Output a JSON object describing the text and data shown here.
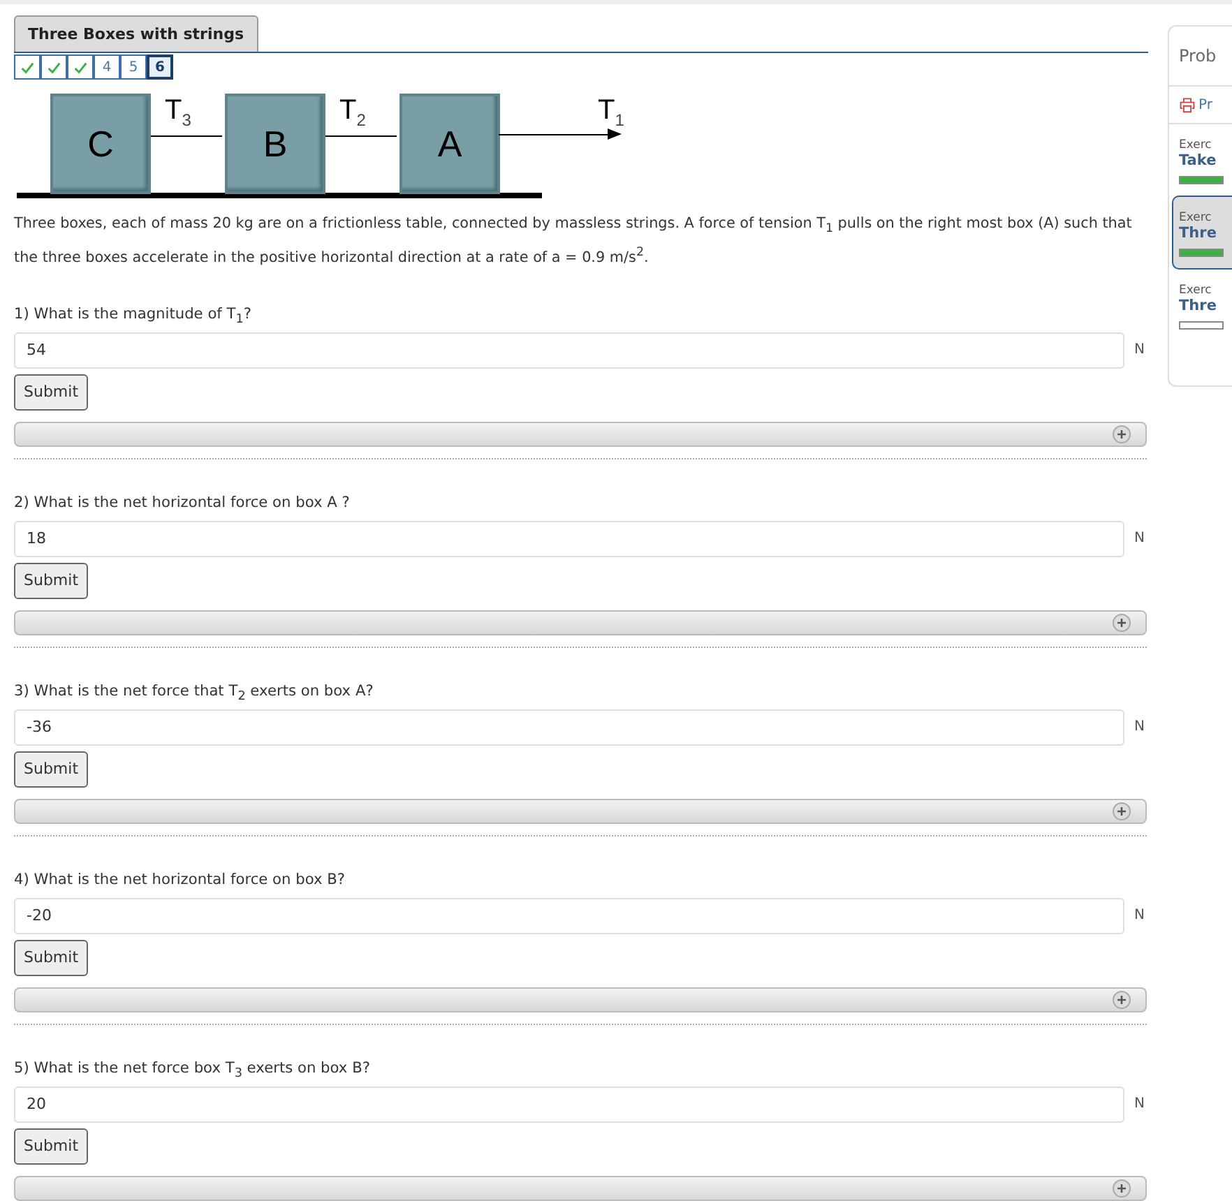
{
  "tab": {
    "title": "Three Boxes with strings"
  },
  "steps": [
    {
      "done": true,
      "selected": false
    },
    {
      "done": true,
      "selected": false
    },
    {
      "done": true,
      "selected": false
    },
    {
      "label": "4",
      "done": false,
      "selected": false
    },
    {
      "label": "5",
      "done": false,
      "selected": false
    },
    {
      "label": "6",
      "done": false,
      "selected": true
    }
  ],
  "diagram": {
    "boxes": [
      "C",
      "B",
      "A"
    ],
    "tensions": [
      "T$_{3}$",
      "T$_{2}$",
      "T$_{1}$"
    ]
  },
  "problem": "Three boxes, each of mass 20 kg are on a frictionless table, connected by massless strings. A force of tension T$_{1}$ pulls on the right most box (A) such that the three boxes accelerate in the positive horizontal direction at a rate of a = 0.9 m/s$^{2}$.",
  "questions": [
    {
      "prompt": "1) What is the magnitude of T$_{1}$?",
      "value": "54",
      "unit": "N",
      "button": "Submit"
    },
    {
      "prompt": "2) What is the net horizontal force on box A ?",
      "value": "18",
      "unit": "N",
      "button": "Submit"
    },
    {
      "prompt": "3) What is the net force that T$_{2}$ exerts on box A?",
      "value": "-36",
      "unit": "N",
      "button": "Submit"
    },
    {
      "prompt": "4) What is the net horizontal force on box B?",
      "value": "-20",
      "unit": "N",
      "button": "Submit"
    },
    {
      "prompt": "5) What is the net force box T$_{3}$ exerts on box B?",
      "value": "20",
      "unit": "N",
      "button": "Submit"
    }
  ],
  "sidebar": {
    "title": "Prob",
    "print": "Pr",
    "items": [
      {
        "label": "Exerc",
        "title": "Take",
        "level": 1,
        "selected": false
      },
      {
        "label": "Exerc",
        "title": "Thre",
        "level": 1,
        "selected": true
      },
      {
        "label": "Exerc",
        "title": "Thre",
        "level": 0,
        "selected": false
      }
    ]
  }
}
